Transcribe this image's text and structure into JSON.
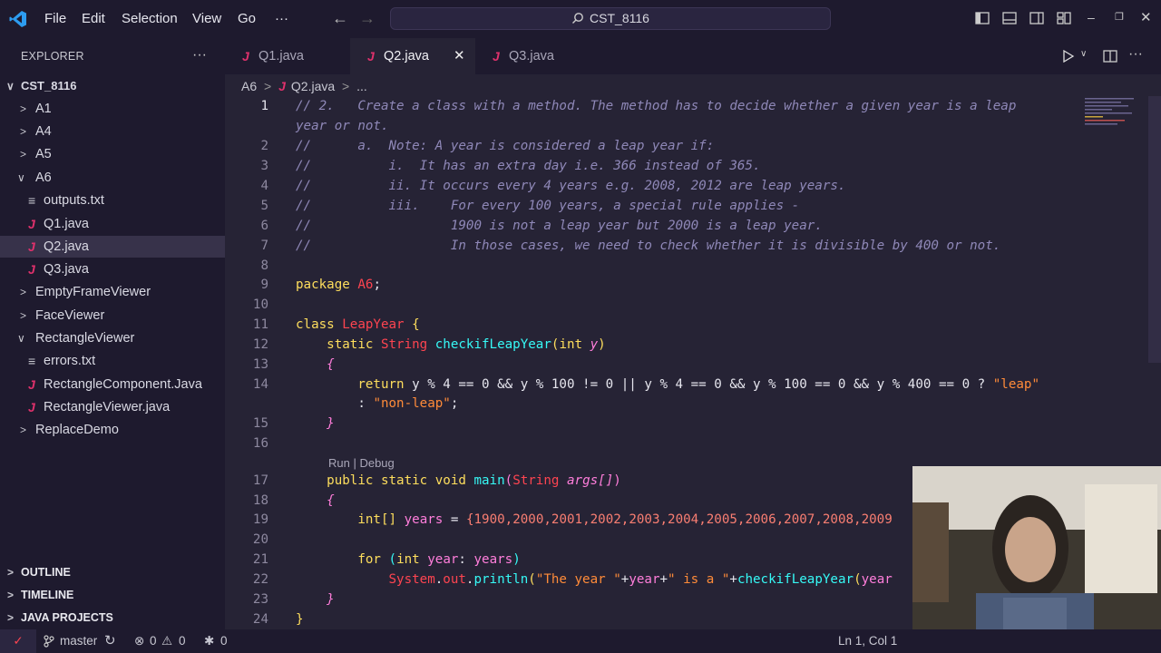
{
  "titlebar": {
    "menu": [
      "File",
      "Edit",
      "Selection",
      "View",
      "Go"
    ],
    "more": "···",
    "search": "CST_8116",
    "window_controls": [
      "minimize",
      "restore",
      "close"
    ]
  },
  "sidebar": {
    "title": "EXPLORER",
    "more": "···",
    "root": "CST_8116",
    "items": [
      {
        "label": "A1",
        "kind": "folder"
      },
      {
        "label": "A4",
        "kind": "folder"
      },
      {
        "label": "A5",
        "kind": "folder"
      },
      {
        "label": "A6",
        "kind": "folder-open"
      },
      {
        "label": "outputs.txt",
        "kind": "txt"
      },
      {
        "label": "Q1.java",
        "kind": "java"
      },
      {
        "label": "Q2.java",
        "kind": "java",
        "selected": true
      },
      {
        "label": "Q3.java",
        "kind": "java"
      },
      {
        "label": "EmptyFrameViewer",
        "kind": "folder"
      },
      {
        "label": "FaceViewer",
        "kind": "folder"
      },
      {
        "label": "RectangleViewer",
        "kind": "folder-open"
      },
      {
        "label": "errors.txt",
        "kind": "txt"
      },
      {
        "label": "RectangleComponent.Java",
        "kind": "java"
      },
      {
        "label": "RectangleViewer.java",
        "kind": "java"
      },
      {
        "label": "ReplaceDemo",
        "kind": "folder"
      }
    ],
    "sections": [
      "OUTLINE",
      "TIMELINE",
      "JAVA PROJECTS"
    ]
  },
  "tabs": [
    {
      "label": "Q1.java",
      "active": false
    },
    {
      "label": "Q2.java",
      "active": true
    },
    {
      "label": "Q3.java",
      "active": false
    }
  ],
  "breadcrumb": {
    "folder": "A6",
    "file": "Q2.java",
    "more": "..."
  },
  "code": {
    "line_numbers": [
      "1",
      "2",
      "3",
      "4",
      "5",
      "6",
      "7",
      "8",
      "9",
      "10",
      "11",
      "12",
      "13",
      "14",
      "15",
      "16",
      "17",
      "18",
      "19",
      "20",
      "21",
      "22",
      "23",
      "24"
    ],
    "codelens": "Run | Debug",
    "comment_1a": "// 2.   Create a class with a method. The method has to decide whether a given year is a leap",
    "comment_1b": "year or not.",
    "comment_2": "//      a.  Note: A year is considered a leap year if:",
    "comment_3": "//          i.  It has an extra day i.e. 366 instead of 365.",
    "comment_4": "//          ii. It occurs every 4 years e.g. 2008, 2012 are leap years.",
    "comment_5": "//          iii.    For every 100 years, a special rule applies -",
    "comment_6": "//                  1900 is not a leap year but 2000 is a leap year.",
    "comment_7": "//                  In those cases, we need to check whether it is divisible by 400 or not.",
    "package_kw": "package",
    "package_name": "A6",
    "class_kw": "class",
    "class_name": "LeapYear",
    "m_static": "static",
    "m_type": "String",
    "m_name": "checkifLeapYear",
    "m_param_type": "int",
    "m_param": "y",
    "ret_kw": "return",
    "ret_expr_a": "y % 4 == 0 && y % 100 != 0 || y % 4 == 0 && y % 100 == 0 && y % 400 == 0 ?",
    "ret_leap": "\"leap\"",
    "ret_colon": ":",
    "ret_nonleap": "\"non-leap\"",
    "main_sig": "public static void",
    "main_name": "main",
    "main_type": "String",
    "main_param": "args[]",
    "arr_decl": "int[]",
    "arr_name": "years",
    "arr_values": "{1900,2000,2001,2002,2003,2004,2005,2006,2007,2008,2009",
    "for_kw": "for",
    "for_int": "int",
    "for_var": "year",
    "for_iter": "years",
    "print_obj": "System",
    "print_out": "out",
    "print_fn": "println",
    "print_s1": "\"The year \"",
    "print_var": "year",
    "print_s2": "\" is a \"",
    "print_call": "checkifLeapYear",
    "print_arg": "year"
  },
  "statusbar": {
    "branch": "master",
    "errors": "0",
    "warnings": "0",
    "ports": "0",
    "position": "Ln 1, Col 1"
  },
  "colors": {
    "background": "#262335",
    "chrome": "#1e1a2e",
    "comment": "#8f88b8",
    "keyword": "#fede5d",
    "type": "#fe4450",
    "function": "#36f9f6",
    "param": "#ff7edb",
    "string": "#ff8b39",
    "number": "#f97e72",
    "java_icon": "#e0316c"
  }
}
